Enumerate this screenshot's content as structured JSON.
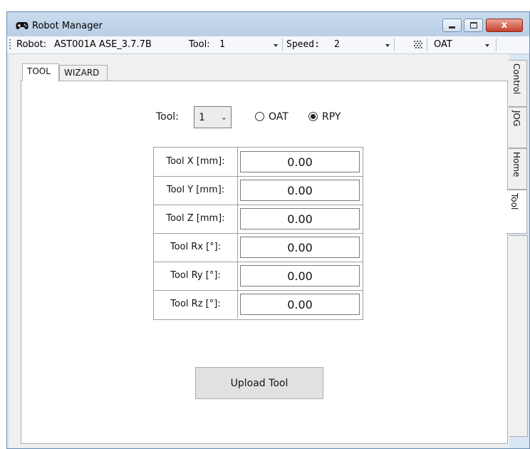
{
  "window": {
    "title": "Robot Manager",
    "close_glyph": "x"
  },
  "toolbar": {
    "robot_label": "Robot:",
    "robot_value": "AST001A ASE_3.7.7B",
    "tool_label": "Tool:",
    "tool_value": "1",
    "speed_label": "Speed:",
    "speed_value": "2",
    "frame_value": "OAT",
    "icon": "grid-dots-icon"
  },
  "tabs": [
    {
      "label": "TOOL"
    },
    {
      "label": "WIZARD"
    }
  ],
  "side_tabs": [
    {
      "label": "Control"
    },
    {
      "label": "JOG"
    },
    {
      "label": "Home"
    },
    {
      "label": "Tool"
    }
  ],
  "tool_form": {
    "tool_label": "Tool:",
    "tool_selected": "1",
    "orientation_options": [
      {
        "label": "OAT",
        "checked": false
      },
      {
        "label": "RPY",
        "checked": true
      }
    ],
    "rows": [
      {
        "label": "Tool X [mm]:",
        "value": "0.00"
      },
      {
        "label": "Tool Y [mm]:",
        "value": "0.00"
      },
      {
        "label": "Tool Z [mm]:",
        "value": "0.00"
      },
      {
        "label": "Tool Rx [°]:",
        "value": "0.00"
      },
      {
        "label": "Tool Ry [°]:",
        "value": "0.00"
      },
      {
        "label": "Tool Rz [°]:",
        "value": "0.00"
      }
    ],
    "upload_label": "Upload Tool"
  },
  "colors": {
    "accent": "#c7402b",
    "titlebar": "#c9dbee"
  }
}
